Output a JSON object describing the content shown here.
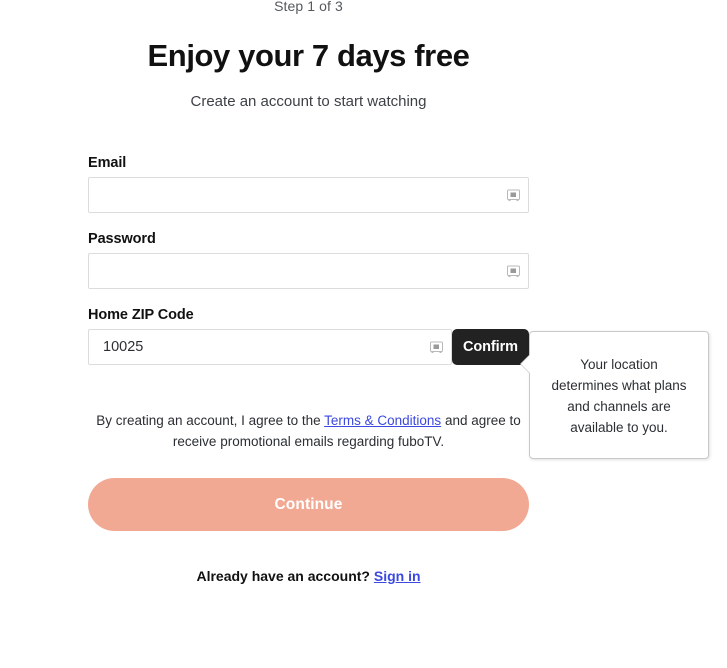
{
  "header": {
    "step_indicator": "Step 1 of 3",
    "title": "Enjoy your 7 days free",
    "subtitle": "Create an account to start watching"
  },
  "form": {
    "email": {
      "label": "Email",
      "value": "",
      "placeholder": "",
      "icon": "password-manager-icon"
    },
    "password": {
      "label": "Password",
      "value": "",
      "placeholder": "",
      "icon": "password-manager-icon"
    },
    "zip": {
      "label": "Home ZIP Code",
      "value": "10025",
      "placeholder": "",
      "icon": "password-manager-icon",
      "confirm_label": "Confirm"
    }
  },
  "tooltip": {
    "text": "Your location determines what plans and channels are available to you."
  },
  "legal": {
    "text_before": "By creating an account, I agree to the ",
    "link_label": "Terms & Conditions",
    "text_after": " and agree to receive promotional emails regarding fuboTV."
  },
  "actions": {
    "continue_label": "Continue"
  },
  "footer": {
    "prompt": "Already have an account?",
    "signin_label": "Sign in"
  },
  "colors": {
    "continue_button": "#f2a994",
    "confirm_button": "#222222",
    "link": "#3b49df",
    "input_border": "#dcdcdc"
  }
}
